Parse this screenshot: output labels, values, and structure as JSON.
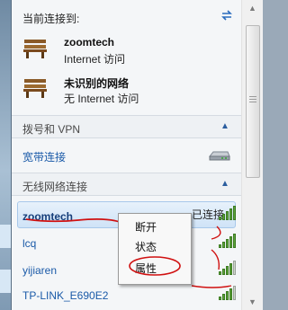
{
  "header": {
    "title": "当前连接到:"
  },
  "current_connections": [
    {
      "name": "zoomtech",
      "status": "Internet 访问"
    },
    {
      "name": "未识别的网络",
      "status": "无 Internet 访问"
    }
  ],
  "sections": {
    "dialup_vpn": "拨号和 VPN",
    "wireless": "无线网络连接"
  },
  "broadband": {
    "label": "宽带连接"
  },
  "wifi_networks": [
    {
      "name": "zoomtech",
      "status": "已连接"
    },
    {
      "name": "lcq"
    },
    {
      "name": "yijiaren"
    },
    {
      "name": "TP-LINK_E690E2"
    }
  ],
  "context_menu": {
    "items": [
      "断开",
      "状态",
      "属性"
    ]
  },
  "colors": {
    "link": "#1a5aa8",
    "annotation": "#d01010",
    "signal": "#5da43a"
  },
  "icons": {
    "refresh": "refresh-icon",
    "bench": "network-bench-icon",
    "modem": "modem-icon",
    "signal": "wifi-signal-icon"
  }
}
